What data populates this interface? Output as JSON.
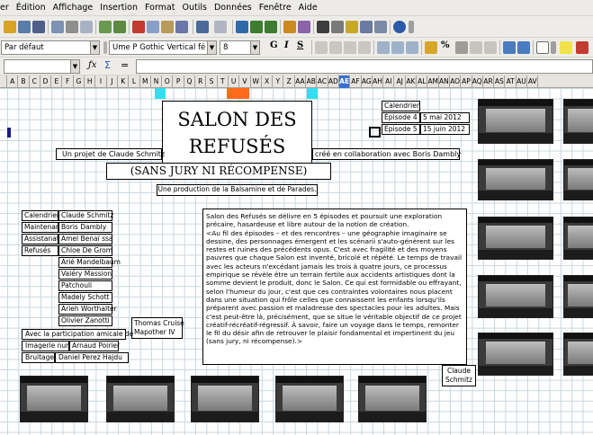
{
  "menu": [
    "er",
    "Édition",
    "Affichage",
    "Insertion",
    "Format",
    "Outils",
    "Données",
    "Fenêtre",
    "Aide"
  ],
  "toolbar": {
    "style_value": "Par défaut",
    "font_value": "Ume P Gothic Vertical fé",
    "size_value": "8",
    "bold": "G",
    "italic": "I",
    "underline": "S",
    "percent": "%"
  },
  "formula": {
    "fx": "ƒx",
    "sum": "Σ",
    "equals": "="
  },
  "columns": [
    "A",
    "B",
    "C",
    "D",
    "E",
    "F",
    "G",
    "H",
    "I",
    "J",
    "K",
    "L",
    "M",
    "N",
    "O",
    "P",
    "Q",
    "R",
    "S",
    "T",
    "U",
    "V",
    "W",
    "X",
    "Y",
    "Z",
    "AA",
    "AB",
    "AC",
    "AD",
    "AE",
    "AF",
    "AG",
    "AH",
    "AI",
    "AJ",
    "AK",
    "AL",
    "AM",
    "AN",
    "AO",
    "AP",
    "AQ",
    "AR",
    "AS",
    "AT",
    "AU",
    "AV"
  ],
  "active_column": "AE",
  "sheet": {
    "title_line1": "SALON DES",
    "title_line2": "REFUSÉS",
    "subtitle": "(SANS JURY NI RÉCOMPENSE)",
    "project": "Un projet de Claude Schmitz",
    "collab": "créé en collaboration avec Boris Dambly",
    "production": "Une production de la Balsamine et de Parades.",
    "calendar": {
      "label": "Calendrier",
      "rows": [
        {
          "episode": "Épisode 4",
          "date": "5 mai 2012"
        },
        {
          "episode": "Épisode 5",
          "date": "15 juin 2012"
        }
      ]
    },
    "credits": [
      {
        "role": "Calendrier",
        "name": "Claude Schmitz"
      },
      {
        "role": "Maintenance",
        "name": "Boris Dambly"
      },
      {
        "role": "Assistanat",
        "name": "Amel Benaï ssa"
      },
      {
        "role": "Refusés",
        "name": "Chloe De Grom"
      }
    ],
    "refuses_extra": [
      "Arié Mandelbaum",
      "Valéry Massion",
      "Patchouli",
      "Madely Schott",
      "Arieh Worthalter",
      "Olivier Zanotti"
    ],
    "thomas": [
      "Thomas Cruise",
      "Mapother IV"
    ],
    "participation": "Avec la participation amicale de",
    "imagerie_role": "Imagerie numérique",
    "imagerie_name": "Arnaud Poirier",
    "bruitages_role": "Bruitages",
    "bruitages_name": "Daniel Perez Hajdu",
    "description": "Salon des Refusés se délivre en 5 épisodes et poursuit une exploration précaire, hasardeuse et libre autour de la notion de création.\n<Au fil des épisodes – et des rencontres – une géographie imaginaire se dessine, des personnages émergent et les scénarii s'auto-génèrent sur les restes et ruines des précédents opus. C'est avec fragilité et des moyens pauvres que chaque Salon est inventé, bricolé et répété. Le temps de travail avec les acteurs n'excédant jamais les trois à quatre jours, ce processus empirique se révèle être un terrain fertile aux accidents artistiques dont la somme devient le produit, donc le Salon. Ce qui est formidable ou effrayant, selon l'humeur du jour, c'est que ces contraintes volontaires nous placent dans une situation qui frôle celles que connaissent les enfants lorsqu'ils préparent avec passion et maladresse des spectacles pour les adultes. Mais c'est peut-être là, précisément, que se situe le véritable objectif de ce projet créatif-récréatif-régressif. À savoir, faire un voyage dans le temps, remonter le fil du désir afin de retrouver le plaisir fondamental et impertinent du jeu (sans jury, ni récompense).>",
    "signature": [
      "Claude",
      "Schmitz"
    ]
  },
  "colors": {
    "cyan_marker": "#2ee0f0",
    "orange_marker": "#ff6a1a",
    "active_header": "#3a6ed0"
  }
}
